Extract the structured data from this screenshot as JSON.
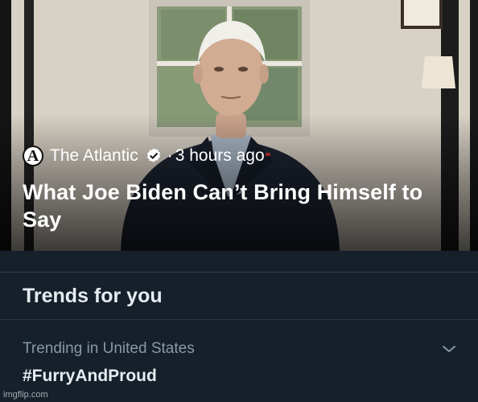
{
  "article": {
    "publisher": "The Atlantic",
    "logo_letter": "A",
    "separator": "·",
    "time_ago": "3 hours ago",
    "headline": "What Joe Biden Can’t Bring Himself to Say",
    "icons": {
      "publisher_logo": "atlantic-logo-icon",
      "verified": "verified-badge-icon"
    }
  },
  "trends": {
    "heading": "Trends for you",
    "items": [
      {
        "context": "Trending in United States",
        "name": "#FurryAndProud",
        "menu_icon": "chevron-down-icon"
      }
    ]
  },
  "watermark": "imgflip.com",
  "colors": {
    "background": "#15202b",
    "divider": "#2b3a47",
    "primary_text": "#e7ecf0",
    "secondary_text": "#8899a6"
  }
}
